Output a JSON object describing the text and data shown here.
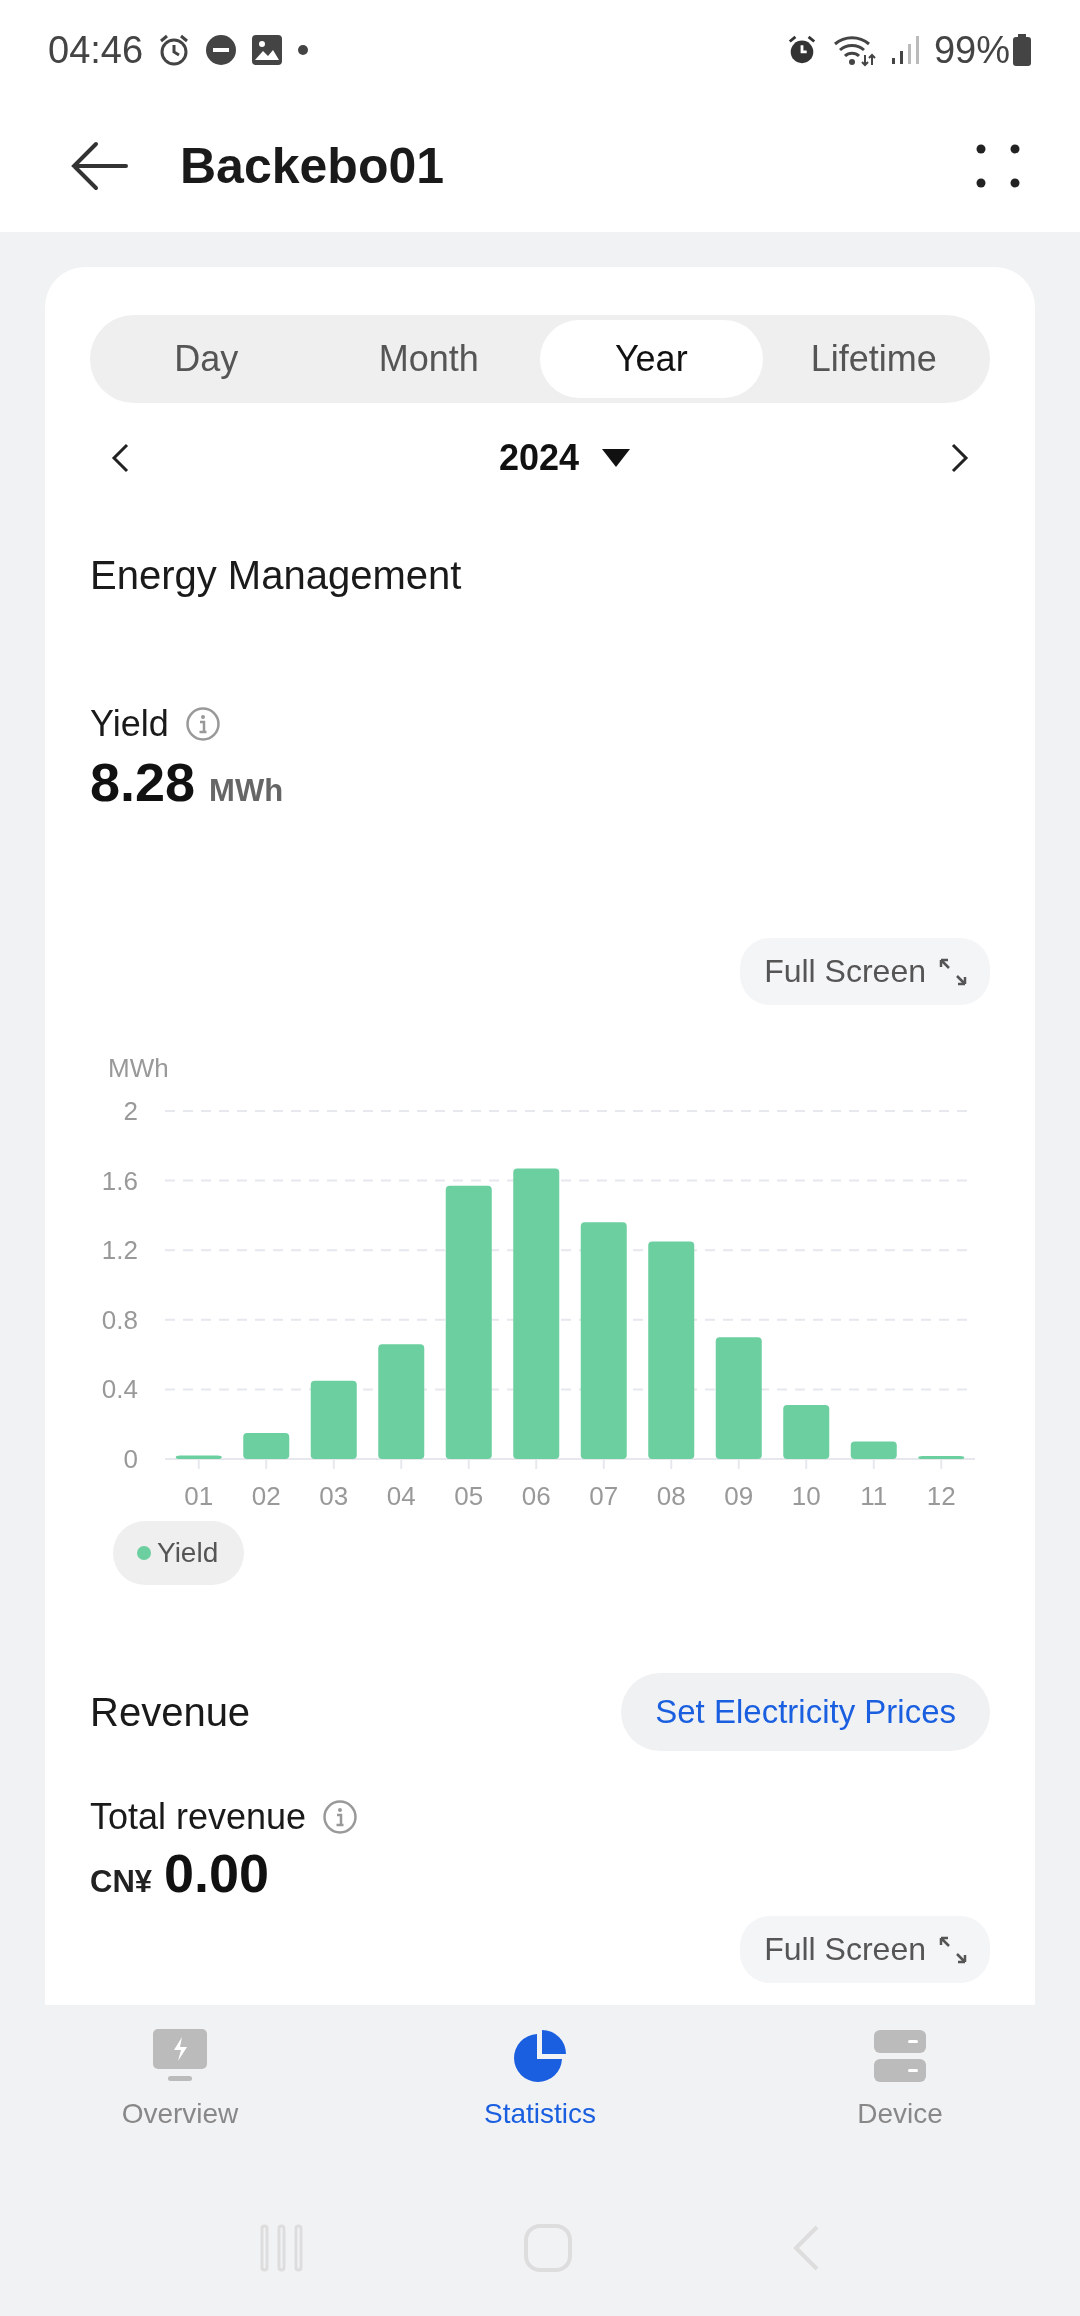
{
  "status_bar": {
    "time": "04:46",
    "battery": "99%"
  },
  "header": {
    "title": "Backebo01"
  },
  "period_tabs": [
    {
      "label": "Day",
      "selected": false
    },
    {
      "label": "Month",
      "selected": false
    },
    {
      "label": "Year",
      "selected": true
    },
    {
      "label": "Lifetime",
      "selected": false
    }
  ],
  "period_picker": {
    "value": "2024"
  },
  "energy": {
    "title": "Energy Management",
    "metric_label": "Yield",
    "value": "8.28",
    "unit": "MWh",
    "full_screen": "Full Screen",
    "chart_data": {
      "type": "bar",
      "ylabel": "MWh",
      "categories": [
        "01",
        "02",
        "03",
        "04",
        "05",
        "06",
        "07",
        "08",
        "09",
        "10",
        "11",
        "12"
      ],
      "yticks": [
        0,
        0.4,
        0.8,
        1.2,
        1.6,
        2
      ],
      "ylim": [
        0,
        2
      ],
      "grid": true,
      "series": [
        {
          "name": "Yield",
          "color": "#6bcf9f",
          "values": [
            0.02,
            0.15,
            0.45,
            0.66,
            1.57,
            1.67,
            1.36,
            1.25,
            0.7,
            0.31,
            0.1,
            0.01
          ]
        }
      ]
    }
  },
  "revenue": {
    "title": "Revenue",
    "action": "Set Electricity Prices",
    "metric_label": "Total revenue",
    "currency": "CN¥",
    "value": "0.00",
    "full_screen": "Full Screen"
  },
  "bottom_nav": [
    {
      "label": "Overview",
      "selected": false,
      "kind": "overview"
    },
    {
      "label": "Statistics",
      "selected": true,
      "kind": "statistics"
    },
    {
      "label": "Device",
      "selected": false,
      "kind": "device"
    }
  ]
}
